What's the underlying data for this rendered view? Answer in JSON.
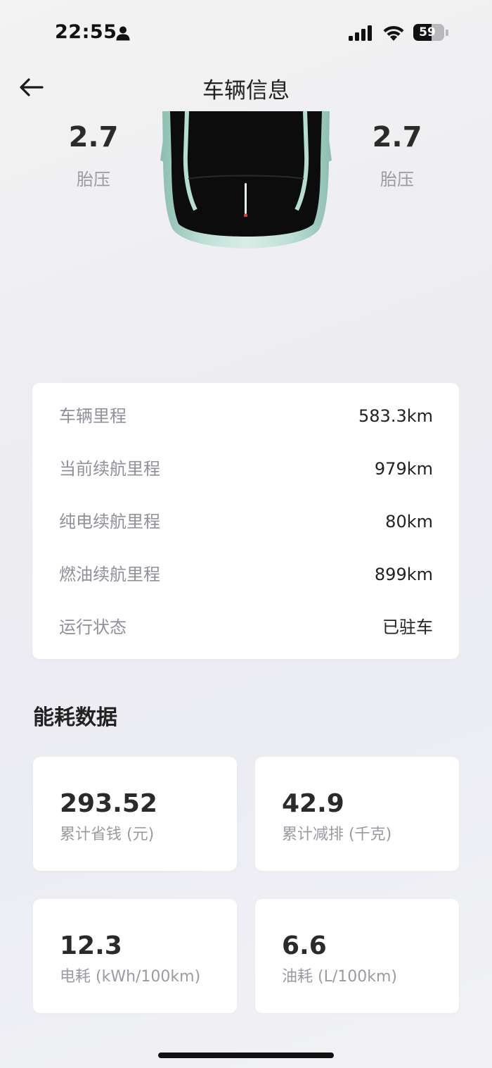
{
  "status_bar": {
    "time": "22:55",
    "battery_percent": 59,
    "battery_text": "59",
    "icons": [
      "person-icon",
      "signal-icon",
      "wifi-icon",
      "battery-icon"
    ]
  },
  "header": {
    "title": "车辆信息",
    "back_icon": "arrow-left-icon"
  },
  "tires": {
    "left": {
      "value": "2.7",
      "label": "胎压"
    },
    "right": {
      "value": "2.7",
      "label": "胎压"
    }
  },
  "vehicle_info": {
    "rows": [
      {
        "label": "车辆里程",
        "value": "583.3km"
      },
      {
        "label": "当前续航里程",
        "value": "979km"
      },
      {
        "label": "纯电续航里程",
        "value": "80km"
      },
      {
        "label": "燃油续航里程",
        "value": "899km"
      },
      {
        "label": "运行状态",
        "value": "已驻车"
      }
    ]
  },
  "energy": {
    "title": "能耗数据",
    "stats": [
      {
        "value": "293.52",
        "label": "累计省钱 (元)"
      },
      {
        "value": "42.9",
        "label": "累计减排 (千克)"
      },
      {
        "value": "12.3",
        "label": "电耗 (kWh/100km)"
      },
      {
        "value": "6.6",
        "label": "油耗 (L/100km)"
      }
    ]
  },
  "colors": {
    "car_body": "#a9d1c6",
    "background": "#ececf1",
    "card": "#ffffff"
  }
}
